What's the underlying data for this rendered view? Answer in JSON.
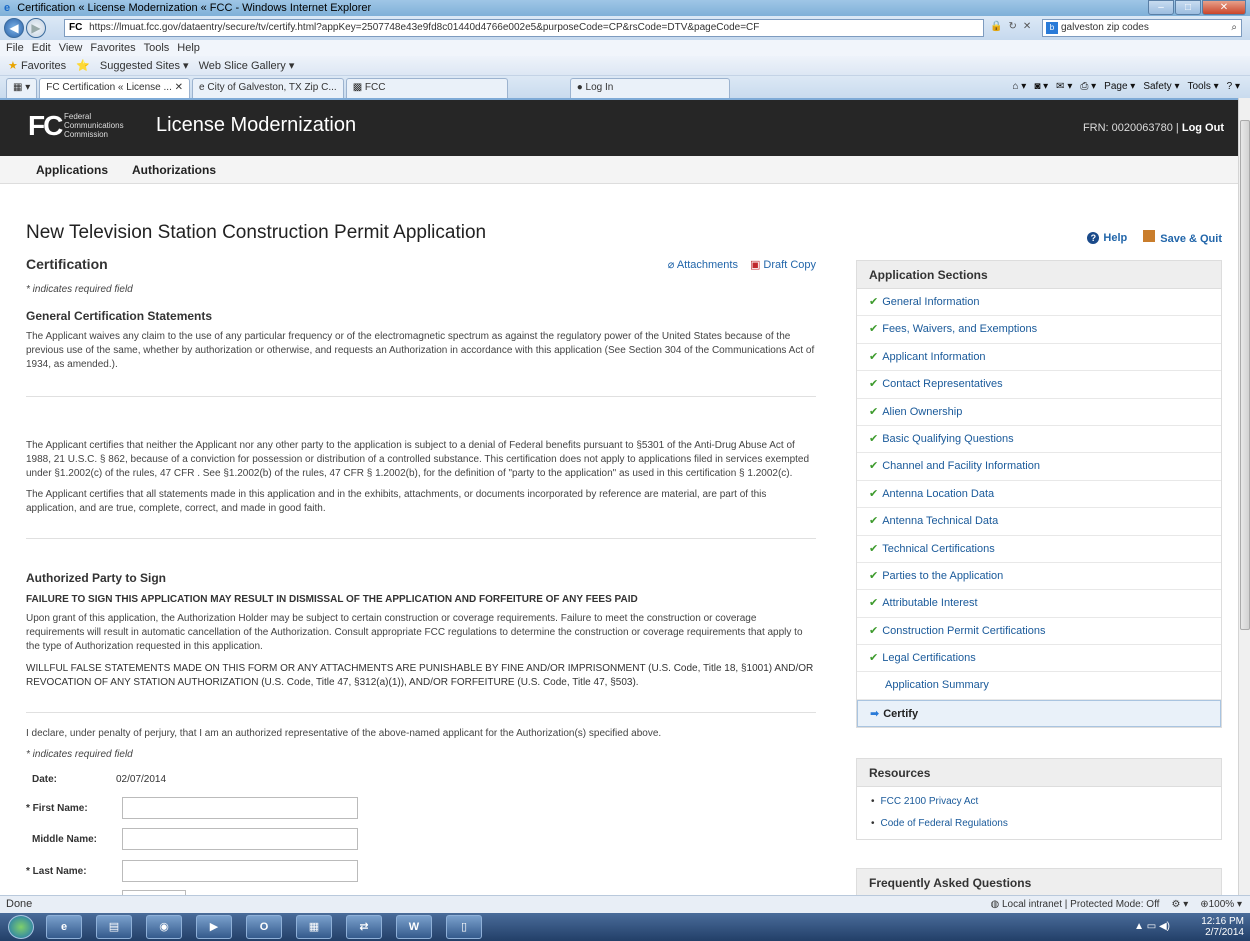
{
  "browser": {
    "window_title": "Certification « License Modernization « FCC - Windows Internet Explorer",
    "url": "https://lmuat.fcc.gov/dataentry/secure/tv/certify.html?appKey=2507748e43e9fd8c01440d4766e002e5&purposeCode=CP&rsCode=DTV&pageCode=CF",
    "url_prefix": "FC",
    "search_text": "galveston zip codes",
    "menu": [
      "File",
      "Edit",
      "View",
      "Favorites",
      "Tools",
      "Help"
    ],
    "favorites_label": "Favorites",
    "fav_items": [
      "Suggested Sites ▾",
      "Web Slice Gallery ▾"
    ],
    "tabs": [
      "Certification « License ...",
      "City of Galveston, TX Zip C...",
      "FCC",
      "Log In"
    ],
    "cmd_items": [
      "Page ▾",
      "Safety ▾",
      "Tools ▾"
    ],
    "status_left": "Done",
    "status_zone": "Local intranet | Protected Mode: Off",
    "status_zoom": "100%"
  },
  "header": {
    "logo_mark": "FC",
    "logo_text": [
      "Federal",
      "Communications",
      "Commission"
    ],
    "app_title": "License Modernization",
    "frn_text": "FRN: 0020063780",
    "separator": "|",
    "logout": "Log Out"
  },
  "subnav": [
    "Applications",
    "Authorizations"
  ],
  "page": {
    "title": "New Television Station Construction Permit Application",
    "help": "Help",
    "save_quit": "Save & Quit",
    "section_title": "Certification",
    "attachments": "Attachments",
    "draft_copy": "Draft Copy",
    "required_note": "* indicates required field",
    "general_heading": "General Certification Statements",
    "general_para": "The Applicant waives any claim to the use of any particular frequency or of the electromagnetic spectrum as against the regulatory power of the United States because of the previous use of the same, whether by authorization or otherwise, and requests an Authorization in accordance with this application (See Section 304 of the Communications Act of 1934, as amended.).",
    "antidrug_para": "The Applicant certifies that neither the Applicant nor any other party to the application is subject to a denial of Federal benefits pursuant to §5301 of the Anti-Drug Abuse Act of 1988, 21 U.S.C. § 862, because of a conviction for possession or distribution of a controlled substance. This certification does not apply to applications filed in services exempted under §1.2002(c) of the rules, 47 CFR . See §1.2002(b) of the rules, 47 CFR § 1.2002(b), for the definition of \"party to the application\" as used in this certification § 1.2002(c).",
    "material_para": "The Applicant certifies that all statements made in this application and in the exhibits, attachments, or documents incorporated by reference are material, are part of this application, and are true, complete, correct, and made in good faith.",
    "auth_heading": "Authorized Party to Sign",
    "failure_caps": "FAILURE TO SIGN THIS APPLICATION MAY RESULT IN DISMISSAL OF THE APPLICATION AND FORFEITURE OF ANY FEES PAID",
    "grant_para": "Upon grant of this application, the Authorization Holder may be subject to certain construction or coverage requirements. Failure to meet the construction or coverage requirements will result in automatic cancellation of the Authorization. Consult appropriate FCC regulations to determine the construction or coverage requirements that apply to the type of Authorization requested in this application.",
    "willful_caps": "WILLFUL FALSE STATEMENTS MADE ON THIS FORM OR ANY ATTACHMENTS ARE PUNISHABLE BY FINE AND/OR IMPRISONMENT (U.S. Code, Title 18, §1001) AND/OR REVOCATION OF ANY STATION AUTHORIZATION (U.S. Code, Title 47, §312(a)(1)), AND/OR FORFEITURE (U.S. Code, Title 47, §503).",
    "declare_para": "I declare, under penalty of perjury, that I am an authorized representative of the above-named applicant for the Authorization(s) specified above.",
    "required_note2": "* indicates required field",
    "date_label": "Date:",
    "date_value": "02/07/2014",
    "first_name_label": "* First Name:",
    "first_name_value": "",
    "middle_name_label": "Middle Name:",
    "middle_name_value": "",
    "last_name_label": "* Last Name:",
    "last_name_value": ""
  },
  "sidebar": {
    "sections_title": "Application Sections",
    "sections": [
      {
        "label": "General Information",
        "done": true
      },
      {
        "label": "Fees, Waivers, and Exemptions",
        "done": true
      },
      {
        "label": "Applicant Information",
        "done": true
      },
      {
        "label": "Contact Representatives",
        "done": true
      },
      {
        "label": "Alien Ownership",
        "done": true
      },
      {
        "label": "Basic Qualifying Questions",
        "done": true
      },
      {
        "label": "Channel and Facility Information",
        "done": true
      },
      {
        "label": "Antenna Location Data",
        "done": true
      },
      {
        "label": "Antenna Technical Data",
        "done": true
      },
      {
        "label": "Technical Certifications",
        "done": true
      },
      {
        "label": "Parties to the Application",
        "done": true
      },
      {
        "label": "Attributable Interest",
        "done": true
      },
      {
        "label": "Construction Permit Certifications",
        "done": true
      },
      {
        "label": "Legal Certifications",
        "done": true
      },
      {
        "label": "Application Summary",
        "done": false
      },
      {
        "label": "Certify",
        "done": false,
        "current": true
      }
    ],
    "resources_title": "Resources",
    "resources": [
      "FCC 2100 Privacy Act",
      "Code of Federal Regulations"
    ],
    "faq_title": "Frequently Asked Questions"
  },
  "taskbar": {
    "time": "12:16 PM",
    "date": "2/7/2014",
    "word_label": "W"
  },
  "colors": {
    "fcc_header": "#262626",
    "link": "#1a5a9a",
    "check": "#3c9a2c",
    "current_section_bg": "#e9f1f9"
  }
}
